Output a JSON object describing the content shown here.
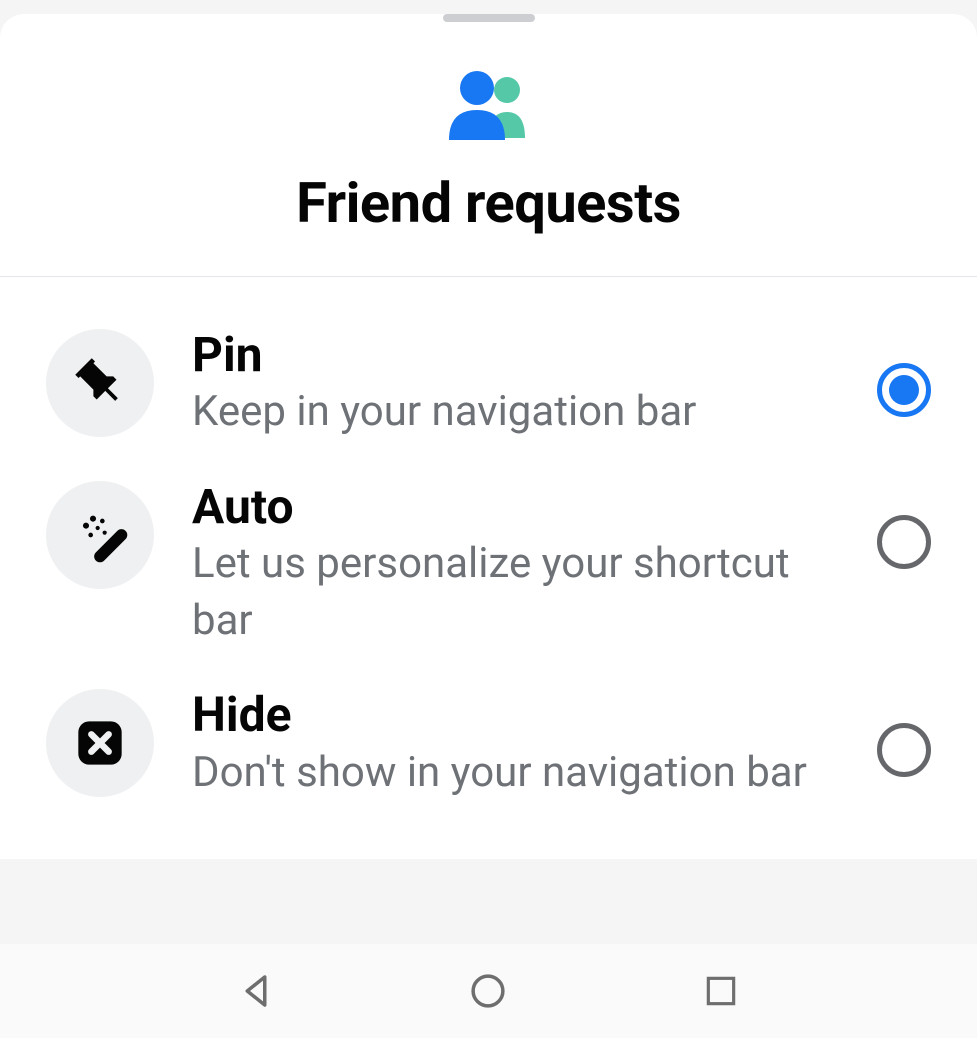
{
  "header": {
    "title": "Friend requests"
  },
  "options": [
    {
      "id": "pin",
      "title": "Pin",
      "description": "Keep in your navigation bar",
      "selected": true
    },
    {
      "id": "auto",
      "title": "Auto",
      "description": "Let us personalize your shortcut bar",
      "selected": false
    },
    {
      "id": "hide",
      "title": "Hide",
      "description": "Don't show in your navigation bar",
      "selected": false
    }
  ],
  "colors": {
    "accent": "#1877f2",
    "iconPrimary": "#1877f2",
    "iconSecondary": "#55c8a8"
  }
}
